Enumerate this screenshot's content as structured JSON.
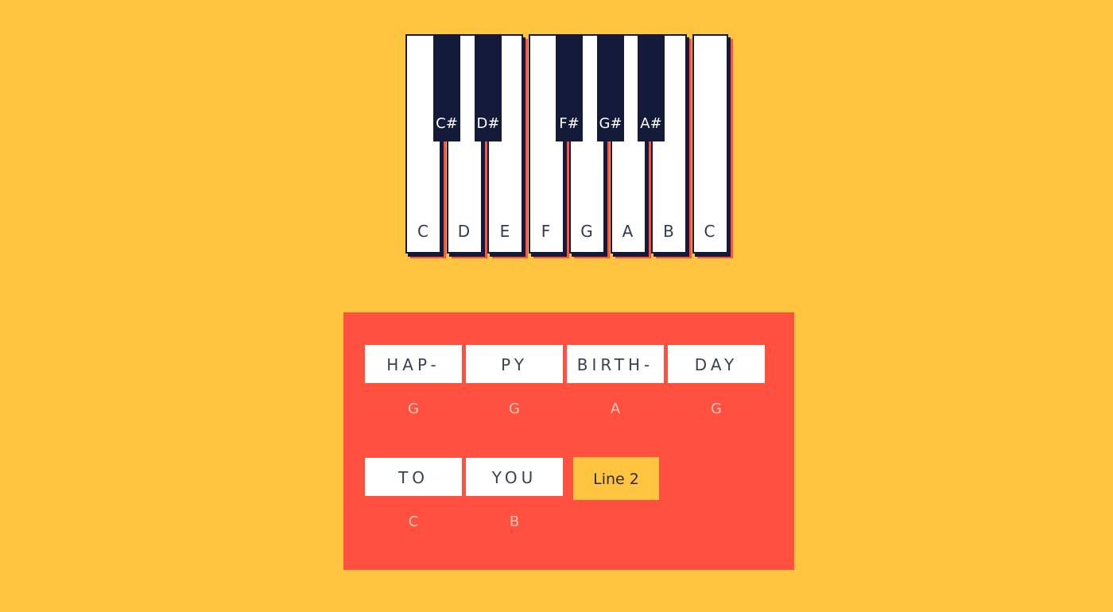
{
  "colors": {
    "background": "#FFC540",
    "panel": "#FF5040",
    "black_key": "#131A3A",
    "white_key": "#FFFFFF"
  },
  "piano": {
    "white_keys": [
      "C",
      "D",
      "E",
      "F",
      "G",
      "A",
      "B",
      "C"
    ],
    "black_keys": [
      "C#",
      "D#",
      "F#",
      "G#",
      "A#"
    ]
  },
  "song": {
    "line1": [
      {
        "syllable": "HAP-",
        "note": "G"
      },
      {
        "syllable": "PY",
        "note": "G"
      },
      {
        "syllable": "BIRTH-",
        "note": "A"
      },
      {
        "syllable": "DAY",
        "note": "G"
      }
    ],
    "line2": [
      {
        "syllable": "TO",
        "note": "C"
      },
      {
        "syllable": "YOU",
        "note": "B"
      }
    ],
    "next_line_button": "Line 2"
  }
}
